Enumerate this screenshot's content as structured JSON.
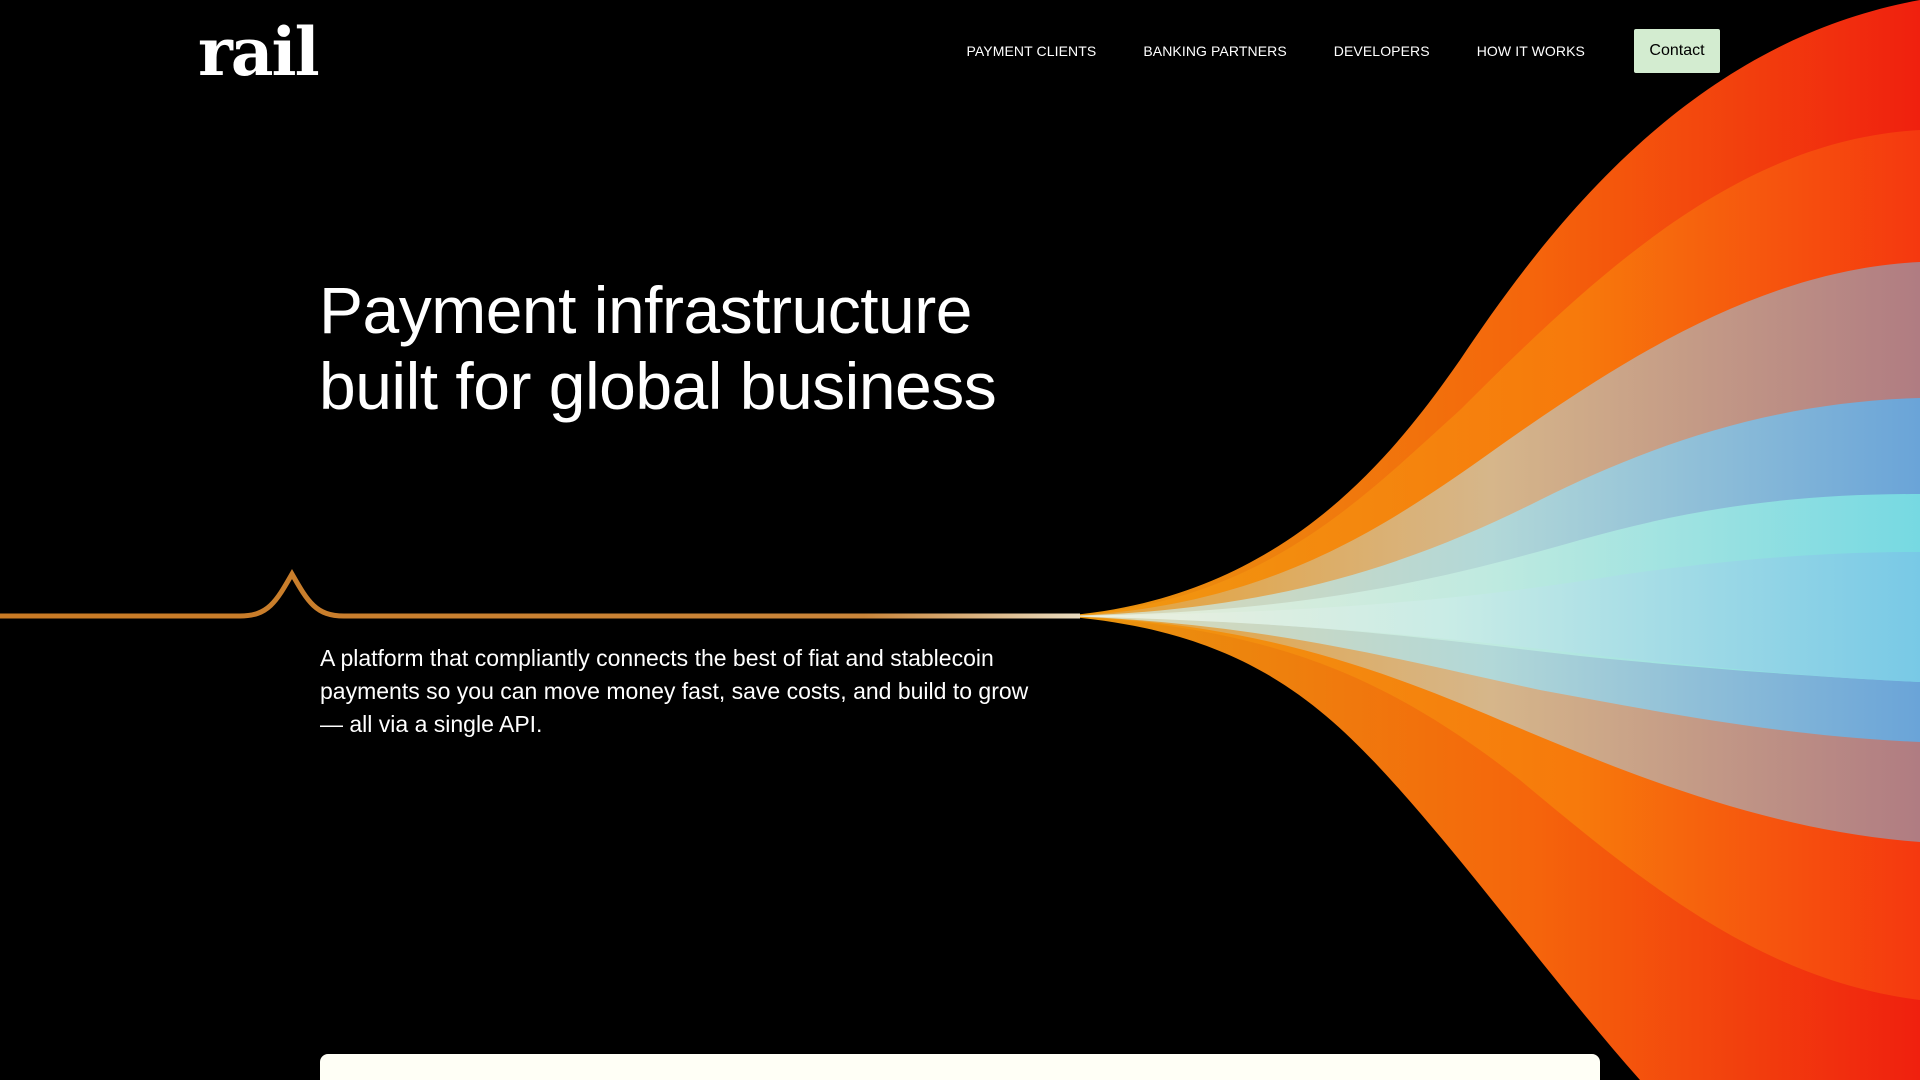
{
  "brand": {
    "logo_text": "rail"
  },
  "nav": {
    "items": [
      {
        "label": "PAYMENT CLIENTS"
      },
      {
        "label": "BANKING PARTNERS"
      },
      {
        "label": "DEVELOPERS"
      },
      {
        "label": "HOW IT WORKS"
      }
    ],
    "contact_label": "Contact"
  },
  "hero": {
    "title_line1": "Payment infrastructure",
    "title_line2": "built for global business",
    "subtitle": "A platform that compliantly connects the best of fiat and stablecoin payments so you can move money fast, save costs, and build to grow — all via a single API."
  },
  "colors": {
    "background": "#000000",
    "text": "#ffffff",
    "contact_button_bg": "#d3ecd0",
    "rail_line": "#c97a24",
    "flow_red": "#f02a10",
    "flow_orange": "#f5820c",
    "flow_amber": "#e8980e",
    "flow_tan": "#c9b88a",
    "flow_mauve": "#b07c7e",
    "flow_blue": "#6fa8d8",
    "flow_cyan": "#7fdde0",
    "panel_bg": "#fffff6"
  }
}
